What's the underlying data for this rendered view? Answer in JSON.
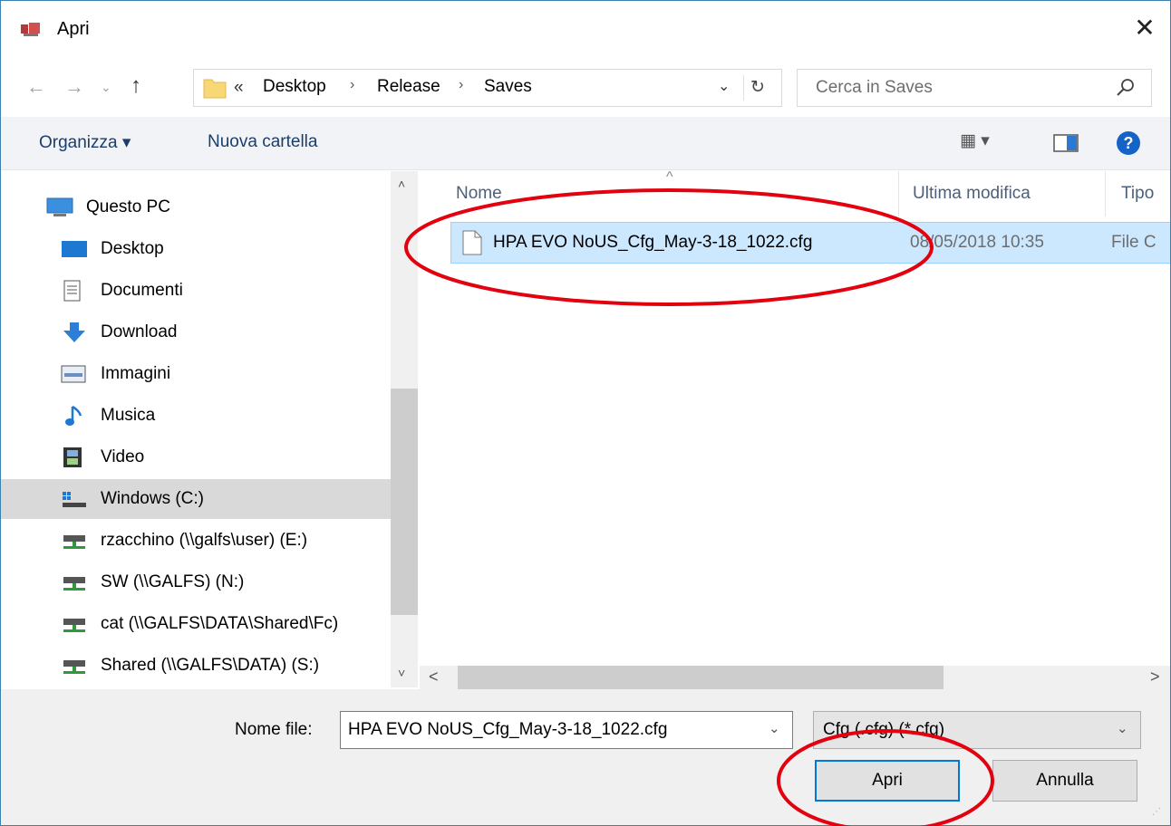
{
  "window": {
    "title": "Apri",
    "close_glyph": "✕",
    "app_icon": "app-icon",
    "accent": "#0078d7"
  },
  "nav": {
    "back_glyph": "←",
    "forward_glyph": "→",
    "recent_glyph": "⌄",
    "up_glyph": "↑",
    "breadcrumb_overflow": "«",
    "breadcrumbs": [
      "Desktop",
      "Release",
      "Saves"
    ],
    "separator": "›",
    "dropdown_glyph": "⌄",
    "refresh_glyph": "↻"
  },
  "search": {
    "placeholder": "Cerca in Saves",
    "icon": "search-icon"
  },
  "toolbar": {
    "organize_label": "Organizza ▾",
    "new_folder_label": "Nuova cartella",
    "view_glyph": "▦ ▾",
    "help_glyph": "?"
  },
  "sidebar": {
    "items": [
      {
        "label": "Questo PC",
        "icon": "computer-icon"
      },
      {
        "label": "Desktop",
        "icon": "desktop-icon"
      },
      {
        "label": "Documenti",
        "icon": "documents-icon"
      },
      {
        "label": "Download",
        "icon": "download-icon"
      },
      {
        "label": "Immagini",
        "icon": "pictures-icon"
      },
      {
        "label": "Musica",
        "icon": "music-icon"
      },
      {
        "label": "Video",
        "icon": "video-icon"
      },
      {
        "label": "Windows (C:)",
        "icon": "windows-drive-icon",
        "selected": true
      },
      {
        "label": "rzacchino (\\\\galfs\\user) (E:)",
        "icon": "network-drive-icon"
      },
      {
        "label": "SW (\\\\GALFS) (N:)",
        "icon": "network-drive-icon"
      },
      {
        "label": "cat (\\\\GALFS\\DATA\\Shared\\Fc)",
        "icon": "network-drive-icon"
      },
      {
        "label": "Shared (\\\\GALFS\\DATA) (S:)",
        "icon": "network-drive-icon"
      }
    ],
    "scroll_up": "˄",
    "scroll_down": "˅"
  },
  "file_list": {
    "columns": [
      "Nome",
      "Ultima modifica",
      "Tipo"
    ],
    "sort_glyph": "^",
    "rows": [
      {
        "name": "HPA EVO NoUS_Cfg_May-3-18_1022.cfg",
        "modified": "08/05/2018 10:35",
        "type": "File C"
      }
    ],
    "scroll_left": "<",
    "scroll_right": ">"
  },
  "footer": {
    "filename_label": "Nome file:",
    "filename_value": "HPA EVO NoUS_Cfg_May-3-18_1022.cfg",
    "filter_value": "Cfg (.cfg) (*.cfg)",
    "dropdown_glyph": "⌄",
    "open_label": "Apri",
    "cancel_label": "Annulla",
    "grip_glyph": "⋰"
  },
  "annotation_color": "#e3000f"
}
